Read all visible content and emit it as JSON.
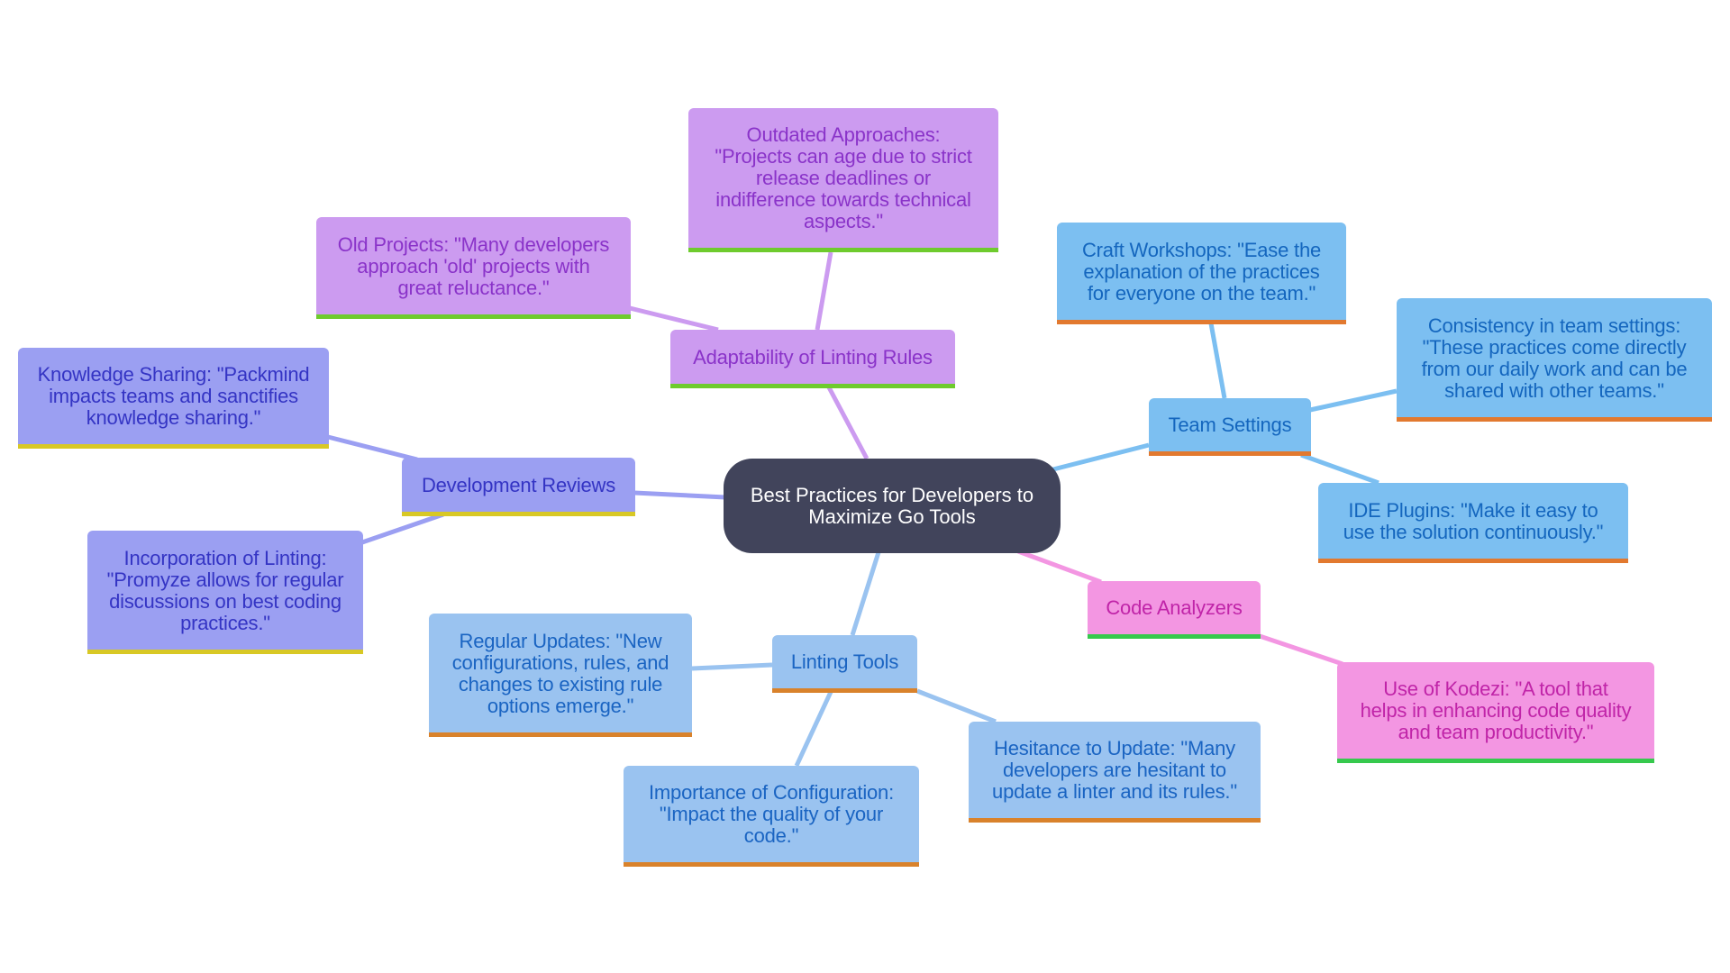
{
  "mindmap": {
    "root": {
      "lines": [
        "Best Practices for Developers",
        "to Maximize Go Tools"
      ],
      "color": "#41445b"
    },
    "branches": [
      {
        "id": "adaptability",
        "label": "Adaptability of Linting Rules",
        "color": "#cc9bf0",
        "children": [
          {
            "id": "outdated",
            "lines": [
              "Outdated Approaches:",
              "\"Projects can age due to strict",
              "release deadlines or",
              "indifference towards technical",
              "aspects.\""
            ]
          },
          {
            "id": "old-projects",
            "lines": [
              "Old Projects: \"Many developers",
              "approach 'old' projects with",
              "great reluctance.\""
            ]
          }
        ]
      },
      {
        "id": "development-reviews",
        "label": "Development Reviews",
        "color": "#9b9ff2",
        "children": [
          {
            "id": "knowledge-sharing",
            "lines": [
              "Knowledge Sharing: \"Packmind",
              "impacts teams and sanctifies",
              "knowledge sharing.\""
            ]
          },
          {
            "id": "incorporation",
            "lines": [
              "Incorporation of Linting:",
              "\"Promyze allows for regular",
              "discussions on best coding",
              "practices.\""
            ]
          }
        ]
      },
      {
        "id": "team-settings",
        "label": "Team Settings",
        "color": "#7cbff1",
        "children": [
          {
            "id": "craft-workshops",
            "lines": [
              "Craft Workshops: \"Ease the",
              "explanation of the practices",
              "for everyone on the team.\""
            ]
          },
          {
            "id": "consistency",
            "lines": [
              "Consistency in team settings:",
              "\"These practices come directly",
              "from our daily work and can be",
              "shared with other teams.\""
            ]
          },
          {
            "id": "ide-plugins",
            "lines": [
              "IDE Plugins: \"Make it easy to",
              "use the solution continuously.\""
            ]
          }
        ]
      },
      {
        "id": "code-analyzers",
        "label": "Code Analyzers",
        "color": "#f396e2",
        "children": [
          {
            "id": "kodezi",
            "lines": [
              "Use of Kodezi: \"A tool that",
              "helps in enhancing code quality",
              "and team productivity.\""
            ]
          }
        ]
      },
      {
        "id": "linting-tools",
        "label": "Linting Tools",
        "color": "#9ac3f0",
        "children": [
          {
            "id": "regular-updates",
            "lines": [
              "Regular Updates: \"New",
              "configurations, rules, and",
              "changes to existing rule",
              "options emerge.\""
            ]
          },
          {
            "id": "hesitance",
            "lines": [
              "Hesitance to Update: \"Many",
              "developers are hesitant to",
              "update a linter and its rules.\""
            ]
          },
          {
            "id": "importance",
            "lines": [
              "Importance of Configuration:",
              "\"Impact the quality of your",
              "code.\""
            ]
          }
        ]
      }
    ]
  }
}
